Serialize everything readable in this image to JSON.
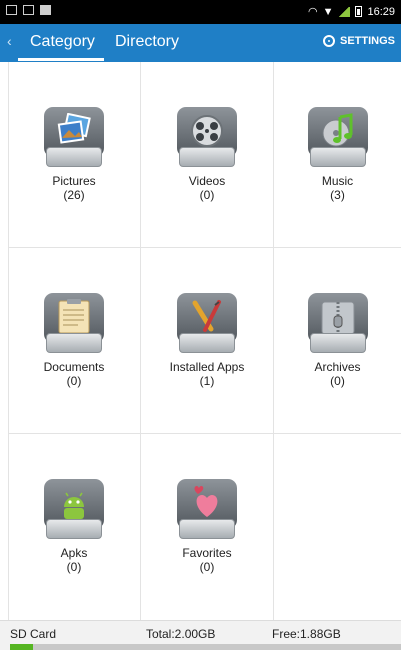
{
  "status_bar": {
    "time": "16:29"
  },
  "app_bar": {
    "back_icon": "back-chevron-icon",
    "tabs": [
      {
        "label": "Category",
        "selected": true
      },
      {
        "label": "Directory",
        "selected": false
      }
    ],
    "settings_label": "SETTINGS",
    "settings_icon": "gear-icon"
  },
  "categories": [
    {
      "name": "Pictures",
      "count": "(26)",
      "icon": "pictures-icon"
    },
    {
      "name": "Videos",
      "count": "(0)",
      "icon": "videos-icon"
    },
    {
      "name": "Music",
      "count": "(3)",
      "icon": "music-icon"
    },
    {
      "name": "Documents",
      "count": "(0)",
      "icon": "documents-icon"
    },
    {
      "name": "Installed Apps",
      "count": "(1)",
      "icon": "installed-apps-icon"
    },
    {
      "name": "Archives",
      "count": "(0)",
      "icon": "archives-icon"
    },
    {
      "name": "Apks",
      "count": "(0)",
      "icon": "apks-icon"
    },
    {
      "name": "Favorites",
      "count": "(0)",
      "icon": "favorites-icon"
    }
  ],
  "storage": {
    "name": "SD Card",
    "total": "Total:2.00GB",
    "free": "Free:1.88GB",
    "used_fraction": 0.06
  },
  "colors": {
    "accent": "#1f7fc6",
    "storage_fill": "#55b521"
  }
}
